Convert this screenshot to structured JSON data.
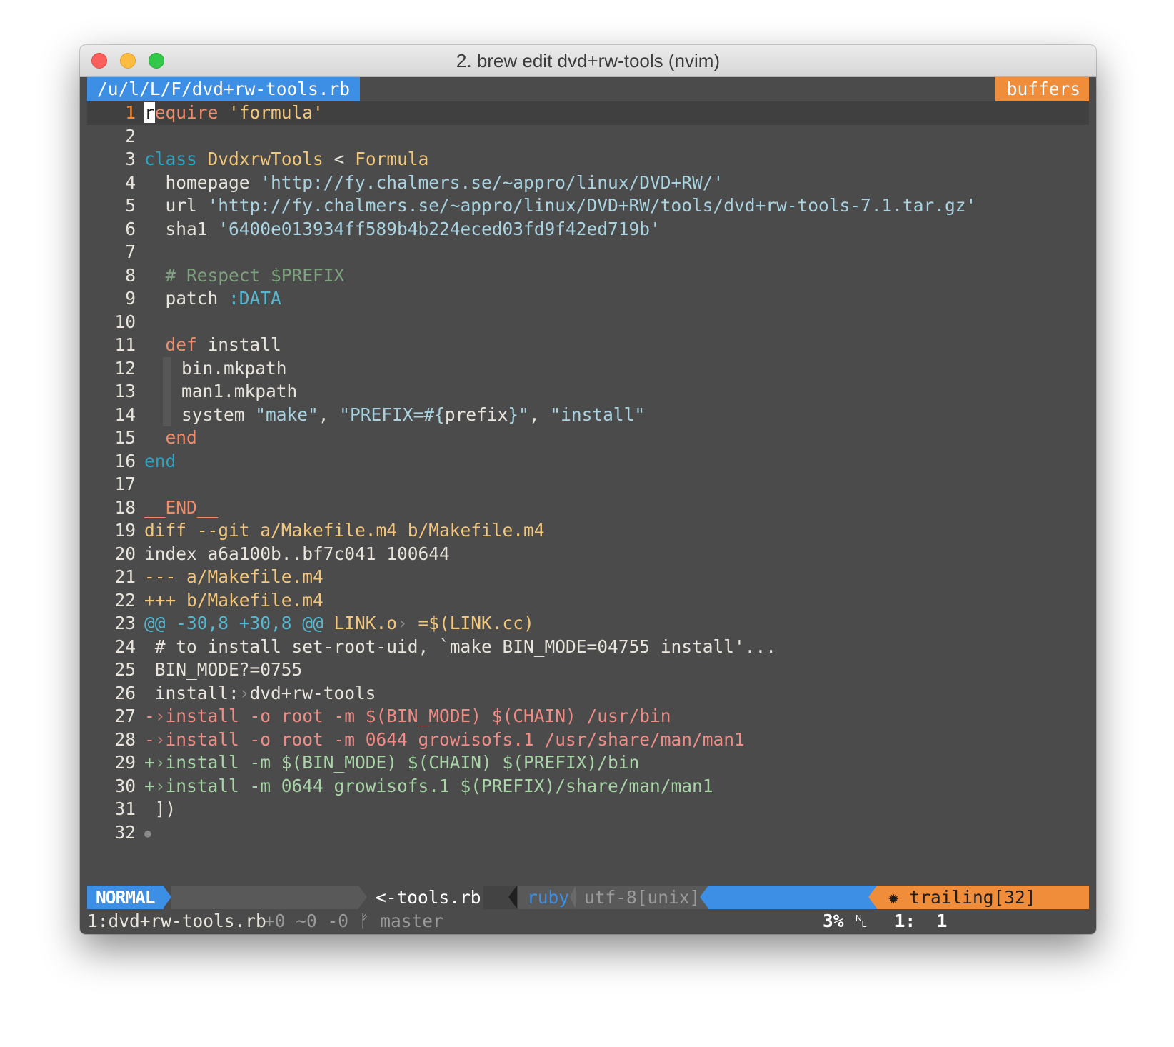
{
  "window": {
    "title": "2. brew edit dvd+rw-tools (nvim)"
  },
  "tabline": {
    "file": "/u/l/L/F/dvd+rw-tools.rb",
    "buffers": "buffers"
  },
  "code": {
    "l1": {
      "n": "1",
      "cursor": "r",
      "a": "equire",
      "b": " ",
      "c": "'formula'"
    },
    "l2": {
      "n": "2"
    },
    "l3": {
      "n": "3",
      "a": "class",
      "b": " ",
      "c": "DvdxrwTools",
      "d": " < ",
      "e": "Formula"
    },
    "l4": {
      "n": "4",
      "a": "  homepage ",
      "b": "'http://fy.chalmers.se/~appro/linux/DVD+RW/'"
    },
    "l5": {
      "n": "5",
      "a": "  url ",
      "b": "'http://fy.chalmers.se/~appro/linux/DVD+RW/tools/dvd+rw-tools-7.1.tar.gz'"
    },
    "l6": {
      "n": "6",
      "a": "  sha1 ",
      "b": "'6400e013934ff589b4b224eced03fd9f42ed719b'"
    },
    "l7": {
      "n": "7"
    },
    "l8": {
      "n": "8",
      "a": "  # Respect $PREFIX"
    },
    "l9": {
      "n": "9",
      "a": "  patch ",
      "b": ":DATA"
    },
    "l10": {
      "n": "10"
    },
    "l11": {
      "n": "11",
      "a": "  ",
      "b": "def",
      "c": " install"
    },
    "l12": {
      "n": "12",
      "a": "bin.mkpath"
    },
    "l13": {
      "n": "13",
      "a": "man1.mkpath"
    },
    "l14": {
      "n": "14",
      "a": "system ",
      "b": "\"make\"",
      "c": ", ",
      "d": "\"PREFIX=#{",
      "e": "prefix",
      "f": "}\"",
      "g": ", ",
      "h": "\"install\""
    },
    "l15": {
      "n": "15",
      "a": "  ",
      "b": "end"
    },
    "l16": {
      "n": "16",
      "a": "end"
    },
    "l17": {
      "n": "17"
    },
    "l18": {
      "n": "18",
      "a": "__END__"
    },
    "l19": {
      "n": "19",
      "a": "diff --git a/Makefile.m4 b/Makefile.m4"
    },
    "l20": {
      "n": "20",
      "a": "index a6a100b..bf7c041 100644"
    },
    "l21": {
      "n": "21",
      "a": "--- a/Makefile.m4"
    },
    "l22": {
      "n": "22",
      "a": "+++ b/Makefile.m4"
    },
    "l23": {
      "n": "23",
      "a": "@@ -30,8 +30,8 @@",
      "b": " LINK.o",
      "c": "›",
      "d": " =$(LINK.cc)"
    },
    "l24": {
      "n": "24",
      "a": " # to install set-root-uid, `make BIN_MODE=04755 install'..."
    },
    "l25": {
      "n": "25",
      "a": " BIN_MODE?=0755"
    },
    "l26": {
      "n": "26",
      "a": " install:",
      "b": "›",
      "c": "dvd+rw-tools"
    },
    "l27": {
      "n": "27",
      "a": "-",
      "b": "›",
      "c": "install -o root -m $(BIN_MODE) $(CHAIN) /usr/bin"
    },
    "l28": {
      "n": "28",
      "a": "-",
      "b": "›",
      "c": "install -o root -m 0644 growisofs.1 /usr/share/man/man1"
    },
    "l29": {
      "n": "29",
      "a": "+",
      "b": "›",
      "c": "install -m $(BIN_MODE) $(CHAIN) $(PREFIX)/bin"
    },
    "l30": {
      "n": "30",
      "a": "+",
      "b": "›",
      "c": "install -m 0644 growisofs.1 $(PREFIX)/share/man/man1"
    },
    "l31": {
      "n": "31",
      "a": " ])"
    },
    "l32": {
      "n": "32",
      "a": "●"
    }
  },
  "statusline": {
    "mode": "NORMAL",
    "git_diff": "+0 ~0 -0",
    "branch_icon": "ᚠ",
    "branch": "master",
    "filename": "<-tools.rb",
    "filetype": "ruby",
    "encoding": "utf-8[unix]",
    "percent": "3%",
    "line_icon": "␤",
    "position": "1:  1",
    "trailing": "✹ trailing[32]"
  },
  "cmdline": "1:dvd+rw-tools.rb",
  "colors": {
    "mode_bg": "#3d8fe6",
    "buffers_bg": "#ef8d3a",
    "trailing_bg": "#ef8d3a",
    "background": "#4b4b4b"
  }
}
